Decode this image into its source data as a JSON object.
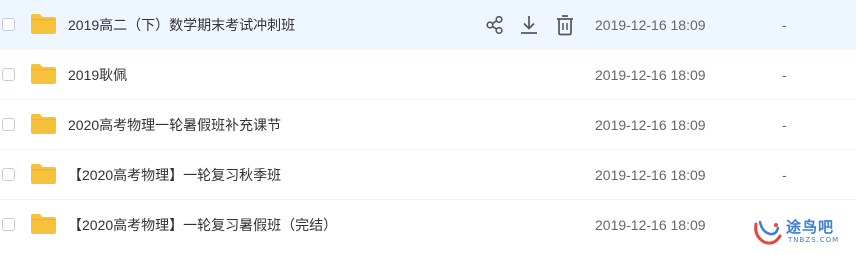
{
  "colors": {
    "folder": "#f7c13b",
    "row_hover_bg": "#eef6ff",
    "icon_gray": "#555555",
    "watermark": "#3d7fd6",
    "watermark_accent": "#e8453c"
  },
  "files": [
    {
      "name": "2019高二（下）数学期末考试冲刺班",
      "date": "2019-12-16 18:09",
      "size": "-",
      "hovered": true
    },
    {
      "name": "2019耿佩",
      "date": "2019-12-16 18:09",
      "size": "-",
      "hovered": false
    },
    {
      "name": "2020高考物理一轮暑假班补充课节",
      "date": "2019-12-16 18:09",
      "size": "-",
      "hovered": false
    },
    {
      "name": "【2020高考物理】一轮复习秋季班",
      "date": "2019-12-16 18:09",
      "size": "-",
      "hovered": false
    },
    {
      "name": "【2020高考物理】一轮复习暑假班（完结）",
      "date": "2019-12-16 18:09",
      "size": "-",
      "hovered": false
    }
  ],
  "row_actions": {
    "share_icon": "share-icon",
    "download_icon": "download-icon",
    "delete_icon": "trash-icon"
  },
  "watermark": {
    "text": "途鸟吧",
    "subtext": "TNBZS.COM"
  }
}
